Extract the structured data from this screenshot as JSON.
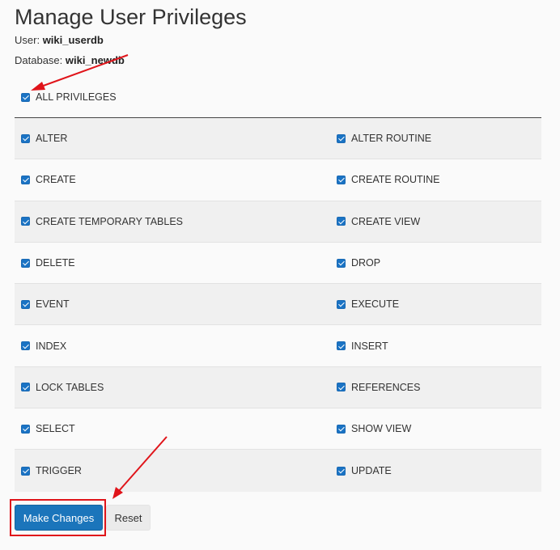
{
  "page": {
    "title": "Manage User Privileges",
    "user_label": "User:",
    "user_value": "wiki_userdb",
    "database_label": "Database:",
    "database_value": "wiki_newdb"
  },
  "all_privileges": {
    "label": "ALL PRIVILEGES",
    "checked": true
  },
  "privileges": {
    "left": [
      {
        "label": "ALTER",
        "checked": true
      },
      {
        "label": "CREATE",
        "checked": true
      },
      {
        "label": "CREATE TEMPORARY TABLES",
        "checked": true
      },
      {
        "label": "DELETE",
        "checked": true
      },
      {
        "label": "EVENT",
        "checked": true
      },
      {
        "label": "INDEX",
        "checked": true
      },
      {
        "label": "LOCK TABLES",
        "checked": true
      },
      {
        "label": "SELECT",
        "checked": true
      },
      {
        "label": "TRIGGER",
        "checked": true
      }
    ],
    "right": [
      {
        "label": "ALTER ROUTINE",
        "checked": true
      },
      {
        "label": "CREATE ROUTINE",
        "checked": true
      },
      {
        "label": "CREATE VIEW",
        "checked": true
      },
      {
        "label": "DROP",
        "checked": true
      },
      {
        "label": "EXECUTE",
        "checked": true
      },
      {
        "label": "INSERT",
        "checked": true
      },
      {
        "label": "REFERENCES",
        "checked": true
      },
      {
        "label": "SHOW VIEW",
        "checked": true
      },
      {
        "label": "UPDATE",
        "checked": true
      }
    ]
  },
  "buttons": {
    "make_changes": "Make Changes",
    "reset": "Reset"
  },
  "colors": {
    "primary": "#1b75bb",
    "annotation": "#e0141a"
  }
}
